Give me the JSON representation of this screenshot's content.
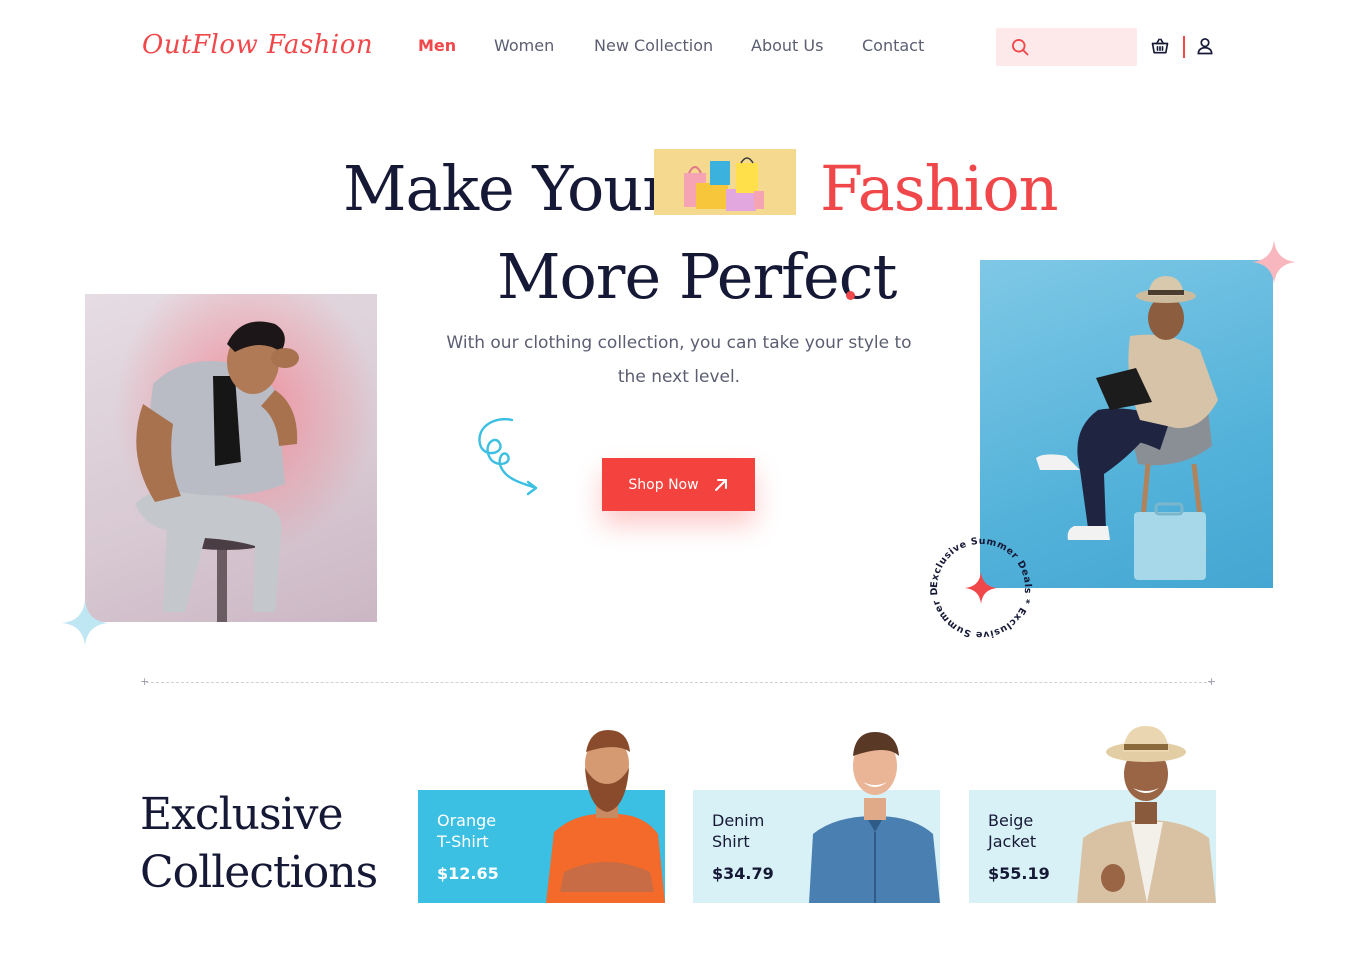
{
  "header": {
    "logo": "OutFlow Fashion",
    "nav": [
      {
        "label": "Men",
        "active": true
      },
      {
        "label": "Women",
        "active": false
      },
      {
        "label": "New Collection",
        "active": false
      },
      {
        "label": "About Us",
        "active": false
      },
      {
        "label": "Contact",
        "active": false
      }
    ],
    "search_value": "",
    "icons": [
      "search-icon",
      "basket-icon",
      "user-icon"
    ]
  },
  "hero": {
    "title_part1": "Make Your",
    "title_accent": "Fashion",
    "title_line2": "More Perfect",
    "subtitle": "With our clothing collection, you can take your style to the next level.",
    "cta_label": "Shop Now",
    "badge_text": "Exclusive Summer Deals * Exclusive Summer Deals * "
  },
  "collections": {
    "title_line1": "Exclusive",
    "title_line2": "Collections",
    "cards": [
      {
        "name": "Orange\nT-Shirt",
        "price": "$12.65",
        "bg": "#3bbfe2",
        "text_color": "#ffffff"
      },
      {
        "name": "Denim\nShirt",
        "price": "$34.79",
        "bg": "#d8f1f6",
        "text_color": "#161936"
      },
      {
        "name": "Beige\nJacket",
        "price": "$55.19",
        "bg": "#d8f1f6",
        "text_color": "#161936"
      }
    ]
  },
  "colors": {
    "accent": "#f0474a",
    "dark": "#161936",
    "muted": "#5b5e72",
    "sky": "#3bbfe2"
  }
}
